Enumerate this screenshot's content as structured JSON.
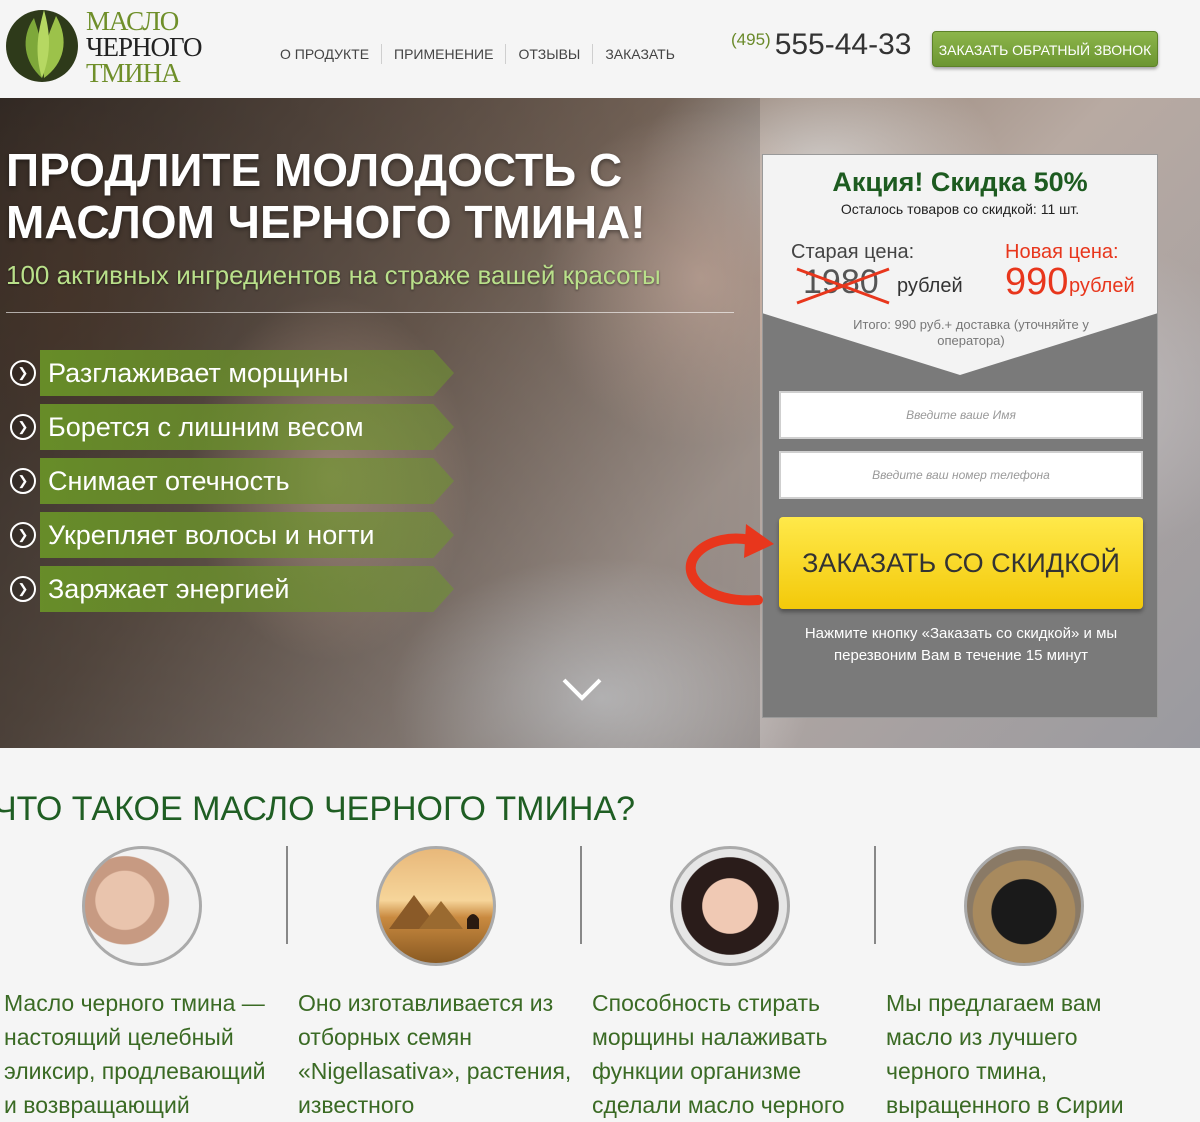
{
  "header": {
    "logo_lines": [
      "МАСЛО",
      "ЧЕРНОГО",
      "ТМИНА"
    ],
    "nav": [
      "О ПРОДУКТЕ",
      "ПРИМЕНЕНИЕ",
      "ОТЗЫВЫ",
      "ЗАКАЗАТЬ"
    ],
    "phone_code": "(495)",
    "phone_number": "555-44-33",
    "callback_label": "ЗАКАЗАТЬ ОБРАТНЫЙ ЗВОНОК"
  },
  "hero": {
    "title": "ПРОДЛИТЕ МОЛОДОСТЬ С МАСЛОМ ЧЕРНОГО ТМИНА!",
    "subtitle": "100 активных ингредиентов на страже вашей красоты",
    "benefits": [
      "Разглаживает морщины",
      "Борется с лишним весом",
      "Снимает отечность",
      "Укрепляет волосы и ногти",
      "Заряжает энергией"
    ]
  },
  "form": {
    "promo_title": "Акция! Скидка 50%",
    "promo_left": "Осталось товаров со скидкой: 11 шт.",
    "old_label": "Старая цена:",
    "old_price": "1980",
    "old_currency": "рублей",
    "new_label": "Новая цена:",
    "new_price": "990",
    "new_currency": "рублей",
    "total_note": "Итого: 990 руб.+ доставка (уточняйте у оператора)",
    "name_placeholder": "Введите ваше Имя",
    "phone_placeholder": "Введите ваш номер телефона",
    "order_button": "ЗАКАЗАТЬ СО СКИДКОЙ",
    "note": "Нажмите кнопку «Заказать со скидкой» и мы перезвоним Вам в течение 15 минут"
  },
  "about": {
    "title": "ЧТО ТАКОЕ МАСЛО ЧЕРНОГО ТМИНА?",
    "columns": [
      "Масло черного тмина — настоящий целебный эликсир, продлевающий и возвращающий",
      "Оно изготавливается из отборных семян «Nigellasativa», растения, известного",
      "Способность стирать морщины налаживать функции организме сделали масло черного",
      "Мы предлагаем вам масло из лучшего черного тмина, выращенного в Сирии"
    ]
  },
  "colors": {
    "brand_green": "#6f8f2a",
    "heading_green": "#1f5e23",
    "sale_red": "#e8361c",
    "button_yellow": "#f3c90a"
  }
}
